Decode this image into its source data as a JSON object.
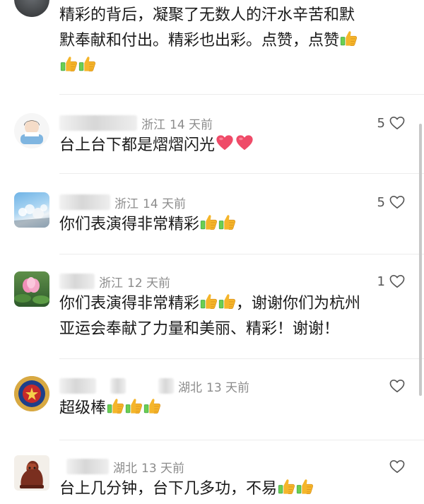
{
  "comments": [
    {
      "line1": "精彩的背后，凝聚了无数人的汗水辛苦和默",
      "line2": "默奉献和付出。精彩也出彩。点赞，点赞",
      "emoji": [
        "thumbs-up",
        "thumbs-up",
        "thumbs-up"
      ]
    },
    {
      "location": "浙江",
      "time": "14 天前",
      "likes": "5",
      "text": "台上台下都是熠熠闪光",
      "emoji": [
        "heart",
        "heart"
      ]
    },
    {
      "location": "浙江",
      "time": "14 天前",
      "likes": "5",
      "text": "你们表演得非常精彩",
      "emoji": [
        "thumbs-up",
        "thumbs-up"
      ]
    },
    {
      "location": "浙江",
      "time": "12 天前",
      "likes": "1",
      "text_a": "你们表演得非常精彩",
      "text_b": "，谢谢你们为杭州",
      "line2": "亚运会奉献了力量和美丽、精彩！谢谢！",
      "emoji": [
        "thumbs-up",
        "thumbs-up"
      ]
    },
    {
      "location_fragment": "湖北",
      "time": "13 天前",
      "text": "超级棒",
      "emoji": [
        "thumbs-up",
        "thumbs-up",
        "thumbs-up"
      ]
    },
    {
      "location_fragment": "湖北",
      "time": "13 天前",
      "text": "台上几分钟，台下几多功，不易",
      "emoji": [
        "thumbs-up",
        "thumbs-up"
      ]
    }
  ],
  "icons": {
    "like": "heart-outline-icon",
    "thumbs_up": "thumbs-up-emoji",
    "heart": "red-heart-emoji"
  },
  "colors": {
    "text": "#1a1a1a",
    "meta": "#8c8c8c",
    "like_icon": "#555555",
    "thumb": "#f5b52a",
    "thumb_cuff": "#4caf50",
    "heart": "#ef4b68"
  }
}
